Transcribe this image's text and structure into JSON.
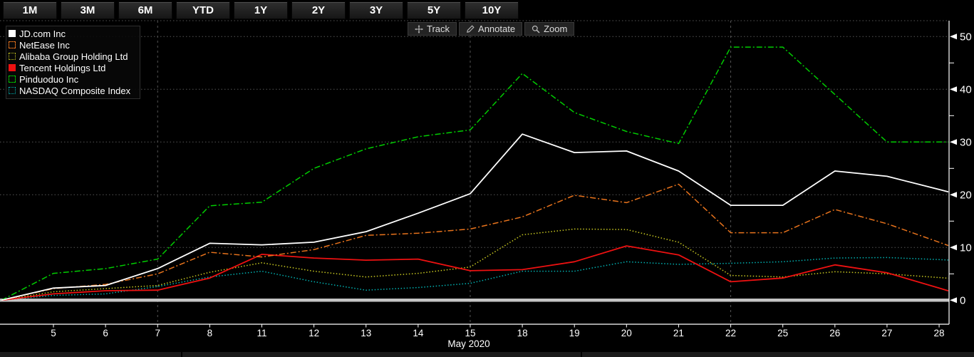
{
  "toolbar": {
    "ranges": [
      "1M",
      "3M",
      "6M",
      "YTD",
      "1Y",
      "2Y",
      "3Y",
      "5Y",
      "10Y"
    ],
    "tools": {
      "track": "Track",
      "annotate": "Annotate",
      "zoom": "Zoom"
    }
  },
  "legend": [
    {
      "label": "JD.com Inc",
      "color": "#ffffff",
      "swatch": "solid"
    },
    {
      "label": "NetEase Inc",
      "color": "#e8731c",
      "swatch": "dash"
    },
    {
      "label": "Alibaba Group Holding Ltd",
      "color": "#c8c820",
      "swatch": "dot"
    },
    {
      "label": "Tencent Holdings Ltd",
      "color": "#ee1111",
      "swatch": "solid"
    },
    {
      "label": "Pinduoduo Inc",
      "color": "#00cc00",
      "swatch": "dash"
    },
    {
      "label": "NASDAQ Composite Index",
      "color": "#00b2b2",
      "swatch": "dot"
    }
  ],
  "chart_data": {
    "type": "line",
    "title": "",
    "x_axis_label": "May 2020",
    "x_tick_labels": [
      "5",
      "6",
      "7",
      "8",
      "11",
      "12",
      "13",
      "14",
      "15",
      "18",
      "19",
      "20",
      "21",
      "22",
      "25",
      "26",
      "27",
      "28"
    ],
    "values_include_unlabeled_start_point": true,
    "y_ticks": [
      0,
      10,
      20,
      30,
      40,
      50
    ],
    "y_minor_ticks": [
      5,
      15,
      25,
      35,
      45
    ],
    "ylim": [
      -2,
      52
    ],
    "grid": "horizontal dotted at each 10, vertical dashed at dates 7 / 15 / 22, thick gray baseline at 0",
    "grid_vertical_at": [
      "7",
      "15",
      "22"
    ],
    "baseline_zero_line": true,
    "series": [
      {
        "name": "JD.com Inc",
        "color": "#ffffff",
        "style": "solid",
        "values": [
          0,
          2.3,
          2.8,
          6.0,
          10.8,
          10.5,
          11.0,
          13.0,
          16.5,
          20.2,
          31.5,
          28.0,
          28.3,
          24.5,
          18.0,
          18.0,
          24.5,
          23.5,
          21.0
        ]
      },
      {
        "name": "NetEase Inc",
        "color": "#e8731c",
        "style": "dashdot",
        "values": [
          0,
          2.2,
          3.0,
          5.0,
          9.1,
          8.2,
          9.6,
          12.3,
          12.7,
          13.5,
          15.8,
          19.9,
          18.5,
          22.0,
          12.8,
          12.8,
          17.2,
          14.5,
          11.0
        ]
      },
      {
        "name": "Alibaba Group Holding Ltd",
        "color": "#c8c820",
        "style": "dot",
        "values": [
          0,
          1.6,
          2.2,
          2.8,
          5.3,
          7.1,
          5.5,
          4.4,
          5.1,
          6.3,
          12.4,
          13.5,
          13.4,
          11.0,
          4.7,
          4.4,
          5.4,
          5.0,
          4.3
        ]
      },
      {
        "name": "Tencent Holdings Ltd",
        "color": "#ee1111",
        "style": "solid",
        "values": [
          0,
          1.2,
          1.8,
          1.9,
          4.2,
          8.7,
          8.0,
          7.6,
          7.8,
          5.6,
          5.8,
          7.3,
          10.3,
          8.6,
          3.5,
          4.2,
          6.7,
          5.2,
          2.3
        ]
      },
      {
        "name": "Pinduoduo Inc",
        "color": "#00cc00",
        "style": "dashdot",
        "values": [
          0,
          5.1,
          6.0,
          7.8,
          17.9,
          18.6,
          25.0,
          28.7,
          31.0,
          32.3,
          43.0,
          35.6,
          32.0,
          29.7,
          48.0,
          48.0,
          39.0,
          30.0,
          30.0
        ]
      },
      {
        "name": "NASDAQ Composite Index",
        "color": "#00b2b2",
        "style": "dot",
        "values": [
          0,
          0.9,
          1.2,
          2.6,
          4.4,
          5.5,
          3.5,
          1.9,
          2.4,
          3.2,
          5.5,
          5.5,
          7.3,
          6.8,
          7.0,
          7.3,
          8.0,
          8.1,
          7.7
        ]
      }
    ]
  }
}
